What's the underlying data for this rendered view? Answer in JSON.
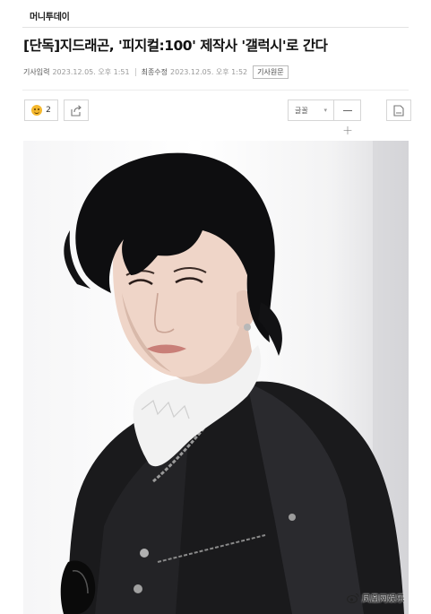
{
  "header": {
    "site_name": "머니투데이"
  },
  "article": {
    "headline": "[단독]지드래곤, '피지컬:100' 제작사 '갤럭시'로 간다",
    "meta": {
      "published_label": "기사입력",
      "published_date": "2023.12.05. 오후 1:51",
      "modified_label": "최종수정",
      "modified_date": "2023.12.05. 오후 1:52",
      "origin_label": "기사원문"
    }
  },
  "toolbar": {
    "reaction_count": "2",
    "font_select_value": "글꼴",
    "size_down_icon": "minus-icon",
    "size_up_icon": "plus-icon",
    "share_icon": "share-icon",
    "print_icon": "print-icon"
  },
  "photo": {
    "subject": "photo"
  },
  "watermark": {
    "text": "凤凰网娱乐",
    "icon": "weibo-icon"
  },
  "colors": {
    "text_primary": "#111111",
    "meta_text": "#777777",
    "border": "#d6d6d6",
    "emoji": "#f5b82e"
  }
}
